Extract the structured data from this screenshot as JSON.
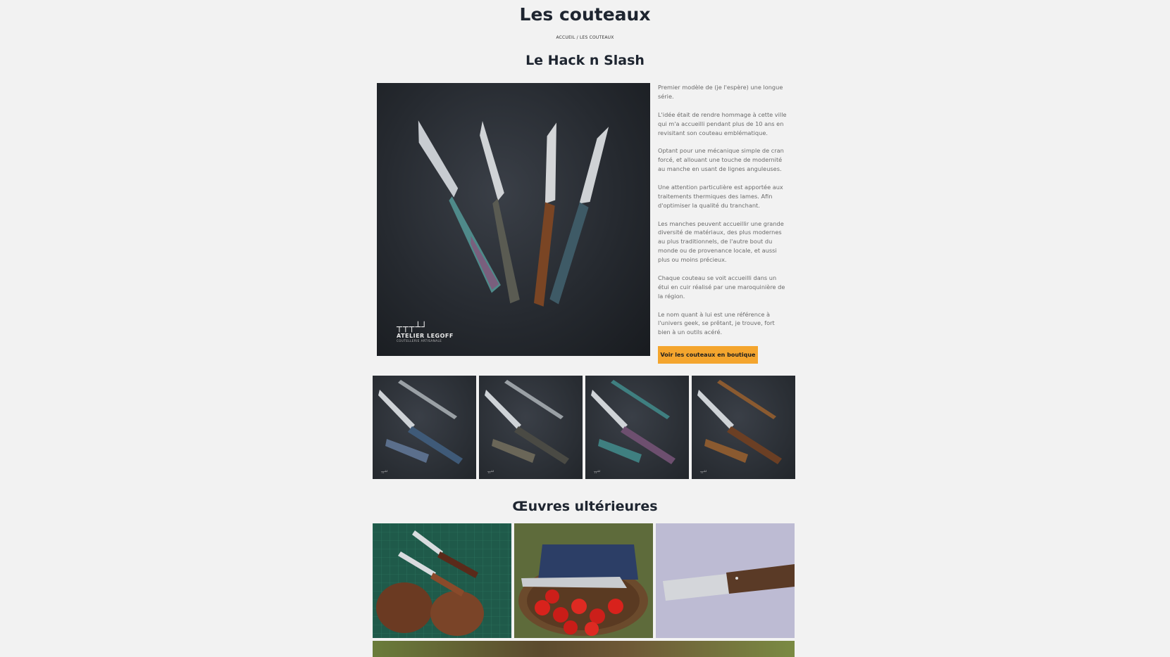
{
  "page": {
    "title": "Les couteaux",
    "breadcrumb": "ACCUEIL / LES COUTEAUX"
  },
  "section_main": {
    "title": "Le Hack n Slash",
    "image_alt": "Le Hack n Slash knives",
    "image_logo": {
      "name": "ATELIER LEGOFF",
      "subtitle": "COUTELLERIE ARTISANALE"
    },
    "paragraphs": [
      "Premier modèle de (je l'espère) une longue série.",
      "L'idée était de rendre hommage à cette ville qui m'a accueilli pendant plus de 10 ans en revisitant son couteau emblématique.",
      "Optant pour une mécanique simple de cran forcé, et allouant une touche de modernité au manche en usant de lignes anguleuses.",
      "Une attention particulière est apportée aux traitements thermiques des lames. Afin d'optimiser la qualité du tranchant.",
      "Les manches peuvent accueillir une grande diversité de matériaux, des plus modernes au plus traditionnels, de l'autre bout du monde ou de provenance locale, et aussi plus ou moins précieux.",
      "Chaque couteau se voit accueilli dans un étui en cuir réalisé par une maroquinière de la région.",
      "Le nom quant à lui est une référence à l'univers geek, se prêtant, je trouve, fort bien à un outils acéré."
    ],
    "button_label": "Voir les couteaux en boutique",
    "button_color": "#f4a52e"
  },
  "thumbnails": [
    {
      "handle_color": "#3f5a78",
      "accent": "#5b6f8c"
    },
    {
      "handle_color": "#4a4a44",
      "accent": "#6a6658"
    },
    {
      "handle_color": "#3f7f80",
      "accent": "#6d4f6f"
    },
    {
      "handle_color": "#6b3f24",
      "accent": "#8a5a30"
    }
  ],
  "section_later": {
    "title": "Œuvres ultérieures"
  },
  "colors": {
    "background": "#f2f2f2",
    "heading": "#1e2530",
    "body_text": "#6b6b6b"
  }
}
